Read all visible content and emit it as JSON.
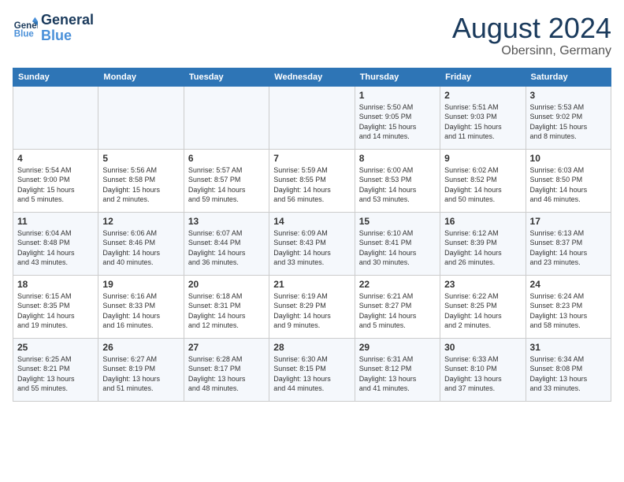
{
  "logo": {
    "line1": "General",
    "line2": "Blue"
  },
  "title": {
    "month_year": "August 2024",
    "location": "Obersinn, Germany"
  },
  "calendar": {
    "headers": [
      "Sunday",
      "Monday",
      "Tuesday",
      "Wednesday",
      "Thursday",
      "Friday",
      "Saturday"
    ],
    "weeks": [
      {
        "days": [
          {
            "number": "",
            "info": "",
            "empty": true
          },
          {
            "number": "",
            "info": "",
            "empty": true
          },
          {
            "number": "",
            "info": "",
            "empty": true
          },
          {
            "number": "",
            "info": "",
            "empty": true
          },
          {
            "number": "1",
            "info": "Sunrise: 5:50 AM\nSunset: 9:05 PM\nDaylight: 15 hours\nand 14 minutes."
          },
          {
            "number": "2",
            "info": "Sunrise: 5:51 AM\nSunset: 9:03 PM\nDaylight: 15 hours\nand 11 minutes."
          },
          {
            "number": "3",
            "info": "Sunrise: 5:53 AM\nSunset: 9:02 PM\nDaylight: 15 hours\nand 8 minutes."
          }
        ]
      },
      {
        "days": [
          {
            "number": "4",
            "info": "Sunrise: 5:54 AM\nSunset: 9:00 PM\nDaylight: 15 hours\nand 5 minutes."
          },
          {
            "number": "5",
            "info": "Sunrise: 5:56 AM\nSunset: 8:58 PM\nDaylight: 15 hours\nand 2 minutes."
          },
          {
            "number": "6",
            "info": "Sunrise: 5:57 AM\nSunset: 8:57 PM\nDaylight: 14 hours\nand 59 minutes."
          },
          {
            "number": "7",
            "info": "Sunrise: 5:59 AM\nSunset: 8:55 PM\nDaylight: 14 hours\nand 56 minutes."
          },
          {
            "number": "8",
            "info": "Sunrise: 6:00 AM\nSunset: 8:53 PM\nDaylight: 14 hours\nand 53 minutes."
          },
          {
            "number": "9",
            "info": "Sunrise: 6:02 AM\nSunset: 8:52 PM\nDaylight: 14 hours\nand 50 minutes."
          },
          {
            "number": "10",
            "info": "Sunrise: 6:03 AM\nSunset: 8:50 PM\nDaylight: 14 hours\nand 46 minutes."
          }
        ]
      },
      {
        "days": [
          {
            "number": "11",
            "info": "Sunrise: 6:04 AM\nSunset: 8:48 PM\nDaylight: 14 hours\nand 43 minutes."
          },
          {
            "number": "12",
            "info": "Sunrise: 6:06 AM\nSunset: 8:46 PM\nDaylight: 14 hours\nand 40 minutes."
          },
          {
            "number": "13",
            "info": "Sunrise: 6:07 AM\nSunset: 8:44 PM\nDaylight: 14 hours\nand 36 minutes."
          },
          {
            "number": "14",
            "info": "Sunrise: 6:09 AM\nSunset: 8:43 PM\nDaylight: 14 hours\nand 33 minutes."
          },
          {
            "number": "15",
            "info": "Sunrise: 6:10 AM\nSunset: 8:41 PM\nDaylight: 14 hours\nand 30 minutes."
          },
          {
            "number": "16",
            "info": "Sunrise: 6:12 AM\nSunset: 8:39 PM\nDaylight: 14 hours\nand 26 minutes."
          },
          {
            "number": "17",
            "info": "Sunrise: 6:13 AM\nSunset: 8:37 PM\nDaylight: 14 hours\nand 23 minutes."
          }
        ]
      },
      {
        "days": [
          {
            "number": "18",
            "info": "Sunrise: 6:15 AM\nSunset: 8:35 PM\nDaylight: 14 hours\nand 19 minutes."
          },
          {
            "number": "19",
            "info": "Sunrise: 6:16 AM\nSunset: 8:33 PM\nDaylight: 14 hours\nand 16 minutes."
          },
          {
            "number": "20",
            "info": "Sunrise: 6:18 AM\nSunset: 8:31 PM\nDaylight: 14 hours\nand 12 minutes."
          },
          {
            "number": "21",
            "info": "Sunrise: 6:19 AM\nSunset: 8:29 PM\nDaylight: 14 hours\nand 9 minutes."
          },
          {
            "number": "22",
            "info": "Sunrise: 6:21 AM\nSunset: 8:27 PM\nDaylight: 14 hours\nand 5 minutes."
          },
          {
            "number": "23",
            "info": "Sunrise: 6:22 AM\nSunset: 8:25 PM\nDaylight: 14 hours\nand 2 minutes."
          },
          {
            "number": "24",
            "info": "Sunrise: 6:24 AM\nSunset: 8:23 PM\nDaylight: 13 hours\nand 58 minutes."
          }
        ]
      },
      {
        "days": [
          {
            "number": "25",
            "info": "Sunrise: 6:25 AM\nSunset: 8:21 PM\nDaylight: 13 hours\nand 55 minutes."
          },
          {
            "number": "26",
            "info": "Sunrise: 6:27 AM\nSunset: 8:19 PM\nDaylight: 13 hours\nand 51 minutes."
          },
          {
            "number": "27",
            "info": "Sunrise: 6:28 AM\nSunset: 8:17 PM\nDaylight: 13 hours\nand 48 minutes."
          },
          {
            "number": "28",
            "info": "Sunrise: 6:30 AM\nSunset: 8:15 PM\nDaylight: 13 hours\nand 44 minutes."
          },
          {
            "number": "29",
            "info": "Sunrise: 6:31 AM\nSunset: 8:12 PM\nDaylight: 13 hours\nand 41 minutes."
          },
          {
            "number": "30",
            "info": "Sunrise: 6:33 AM\nSunset: 8:10 PM\nDaylight: 13 hours\nand 37 minutes."
          },
          {
            "number": "31",
            "info": "Sunrise: 6:34 AM\nSunset: 8:08 PM\nDaylight: 13 hours\nand 33 minutes."
          }
        ]
      }
    ]
  }
}
